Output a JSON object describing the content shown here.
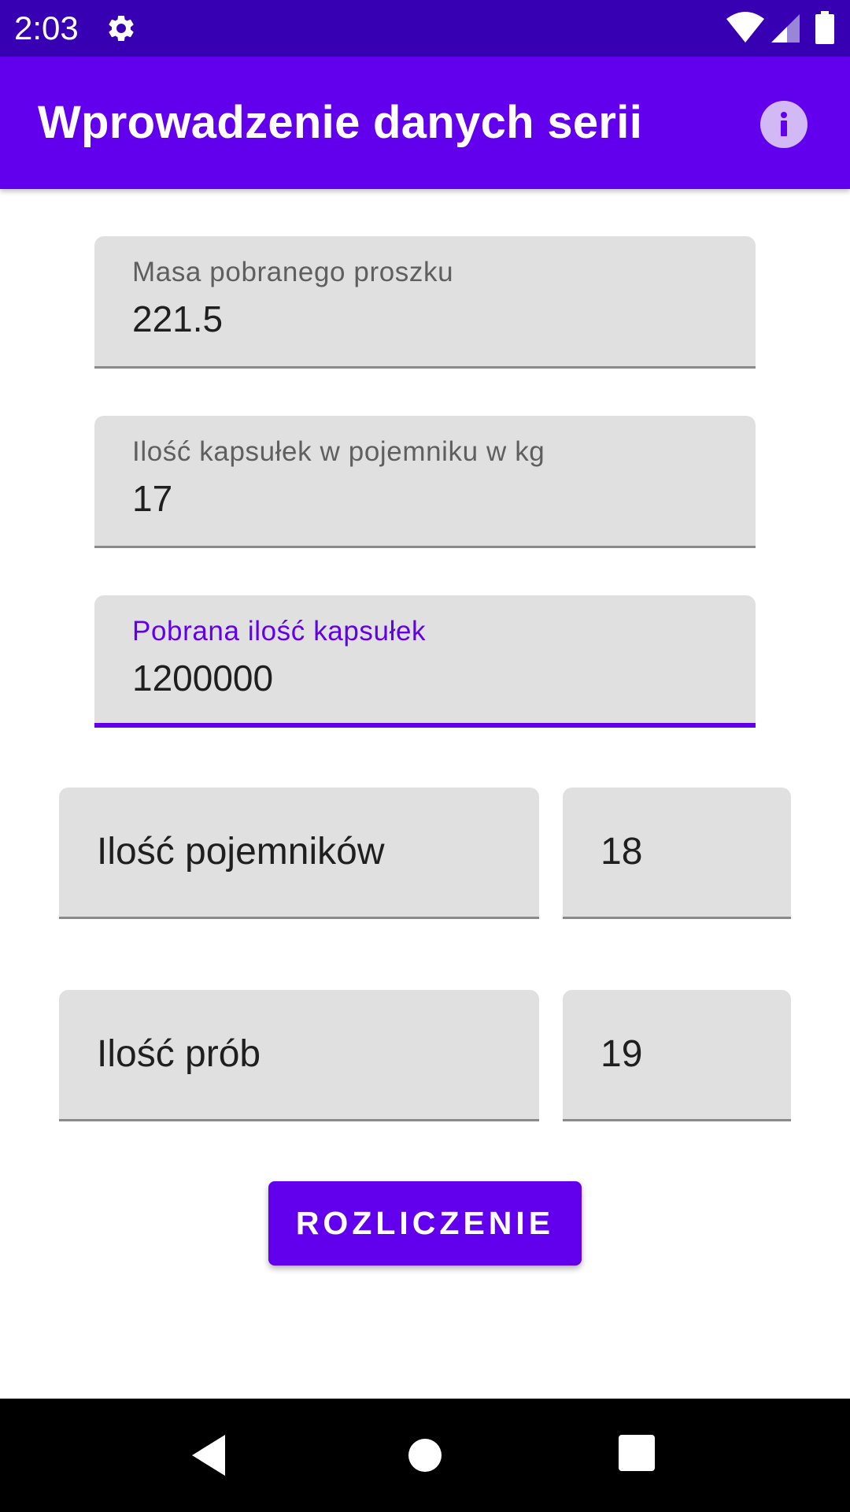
{
  "status_bar": {
    "time": "2:03",
    "icons": [
      "gear-icon",
      "wifi-icon",
      "signal-icon",
      "battery-icon"
    ]
  },
  "app_bar": {
    "title": "Wprowadzenie danych serii",
    "info_icon": "info-icon"
  },
  "form": {
    "powder_mass": {
      "label": "Masa pobranego proszku",
      "value": "221.5"
    },
    "capsules_per_container": {
      "label": "Ilość kapsułek w pojemniku w kg",
      "value": "17"
    },
    "capsules_taken": {
      "label": "Pobrana ilość kapsułek",
      "value": "1200000"
    },
    "containers": {
      "label": "Ilość pojemników",
      "value": "18"
    },
    "samples": {
      "label": "Ilość prób",
      "value": "19"
    }
  },
  "actions": {
    "calculate_label": "ROZLICZENIE"
  },
  "nav_bar": {
    "icons": [
      "back-icon",
      "home-icon",
      "recents-icon"
    ]
  },
  "colors": {
    "status_bar": "#3700b3",
    "primary": "#6200ee",
    "field_background": "#e0e0e0",
    "info_circle": "#d2b8f5"
  }
}
